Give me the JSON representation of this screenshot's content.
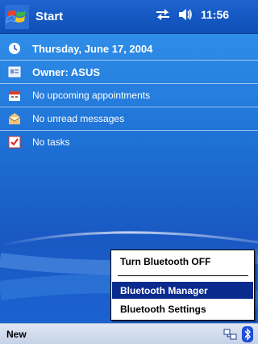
{
  "topbar": {
    "start_label": "Start",
    "time": "11:56",
    "icons": [
      "windows-flag-icon",
      "connectivity-icon",
      "speaker-icon"
    ]
  },
  "today": {
    "date": "Thursday, June 17, 2004",
    "owner": "Owner: ASUS",
    "appointments": "No upcoming appointments",
    "messages": "No unread messages",
    "tasks": "No tasks"
  },
  "menu": {
    "items": [
      "Turn Bluetooth OFF",
      "Bluetooth Manager",
      "Bluetooth Settings"
    ],
    "selected_index": 1
  },
  "bottombar": {
    "new_label": "New",
    "icons": [
      "network-tray-icon",
      "bluetooth-tray-icon"
    ]
  },
  "colors": {
    "titlebar": "#1e63cf",
    "desktop": "#1d6fd4",
    "menu_selected": "#0b2a8e",
    "bottombar": "#d3dcec"
  }
}
